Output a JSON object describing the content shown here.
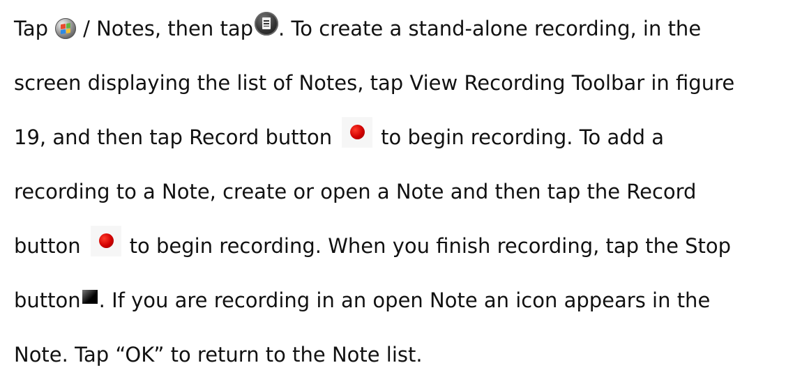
{
  "paragraph": {
    "l1": {
      "s1": "Tap",
      "s2": "/ Notes, then tap",
      "s3": ". To create a stand-alone recording, in the"
    },
    "l2": {
      "s1": "screen displaying the list of Notes, tap View Recording Toolbar in figure"
    },
    "l3": {
      "s1": "19, and then tap Record button",
      "s2": "to begin recording. To add a"
    },
    "l4": {
      "s1": "recording to a Note, create or open a Note and then tap the Record"
    },
    "l5": {
      "s1": "button",
      "s2": "to begin recording. When you finish recording, tap the Stop"
    },
    "l6": {
      "s1": "button",
      "s2": ". If you are recording in an open Note an icon appears in the"
    },
    "l7": {
      "s1": "Note. Tap “OK” to return to the Note list."
    }
  },
  "icons": {
    "start": "windows-start-icon",
    "menu": "notes-menu-icon",
    "record": "record-button-icon",
    "stop": "stop-button-icon"
  },
  "colors": {
    "record": "#d00000",
    "stop": "#000000",
    "text": "#111111"
  }
}
